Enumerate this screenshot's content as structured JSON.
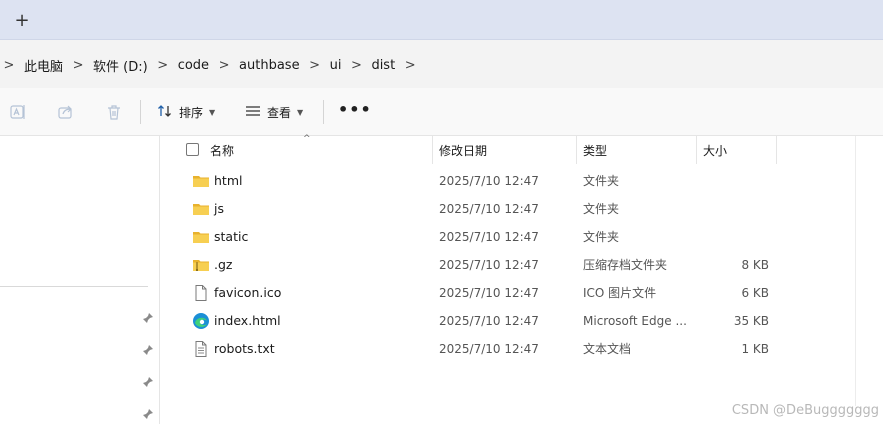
{
  "tabbar": {
    "add_icon": "+"
  },
  "breadcrumb": {
    "items": [
      "此电脑",
      "软件 (D:)",
      "code",
      "authbase",
      "ui",
      "dist"
    ],
    "separator": ">"
  },
  "toolbar": {
    "sort_label": "排序",
    "view_label": "查看",
    "more_label": "•••"
  },
  "columns": {
    "name": "名称",
    "date": "修改日期",
    "type": "类型",
    "size": "大小"
  },
  "files": [
    {
      "name": "html",
      "date": "2025/7/10 12:47",
      "type": "文件夹",
      "size": "",
      "icon": "folder-icon"
    },
    {
      "name": "js",
      "date": "2025/7/10 12:47",
      "type": "文件夹",
      "size": "",
      "icon": "folder-icon"
    },
    {
      "name": "static",
      "date": "2025/7/10 12:47",
      "type": "文件夹",
      "size": "",
      "icon": "folder-icon"
    },
    {
      "name": ".gz",
      "date": "2025/7/10 12:47",
      "type": "压缩存档文件夹",
      "size": "8 KB",
      "icon": "zip-folder-icon"
    },
    {
      "name": "favicon.ico",
      "date": "2025/7/10 12:47",
      "type": "ICO 图片文件",
      "size": "6 KB",
      "icon": "file-icon"
    },
    {
      "name": "index.html",
      "date": "2025/7/10 12:47",
      "type": "Microsoft Edge ...",
      "size": "35 KB",
      "icon": "edge-icon"
    },
    {
      "name": "robots.txt",
      "date": "2025/7/10 12:47",
      "type": "文本文档",
      "size": "1 KB",
      "icon": "text-file-icon"
    }
  ],
  "watermark": "CSDN @DeBuggggggg",
  "colors": {
    "folder": "#f4c542",
    "accent": "#0067c0"
  }
}
